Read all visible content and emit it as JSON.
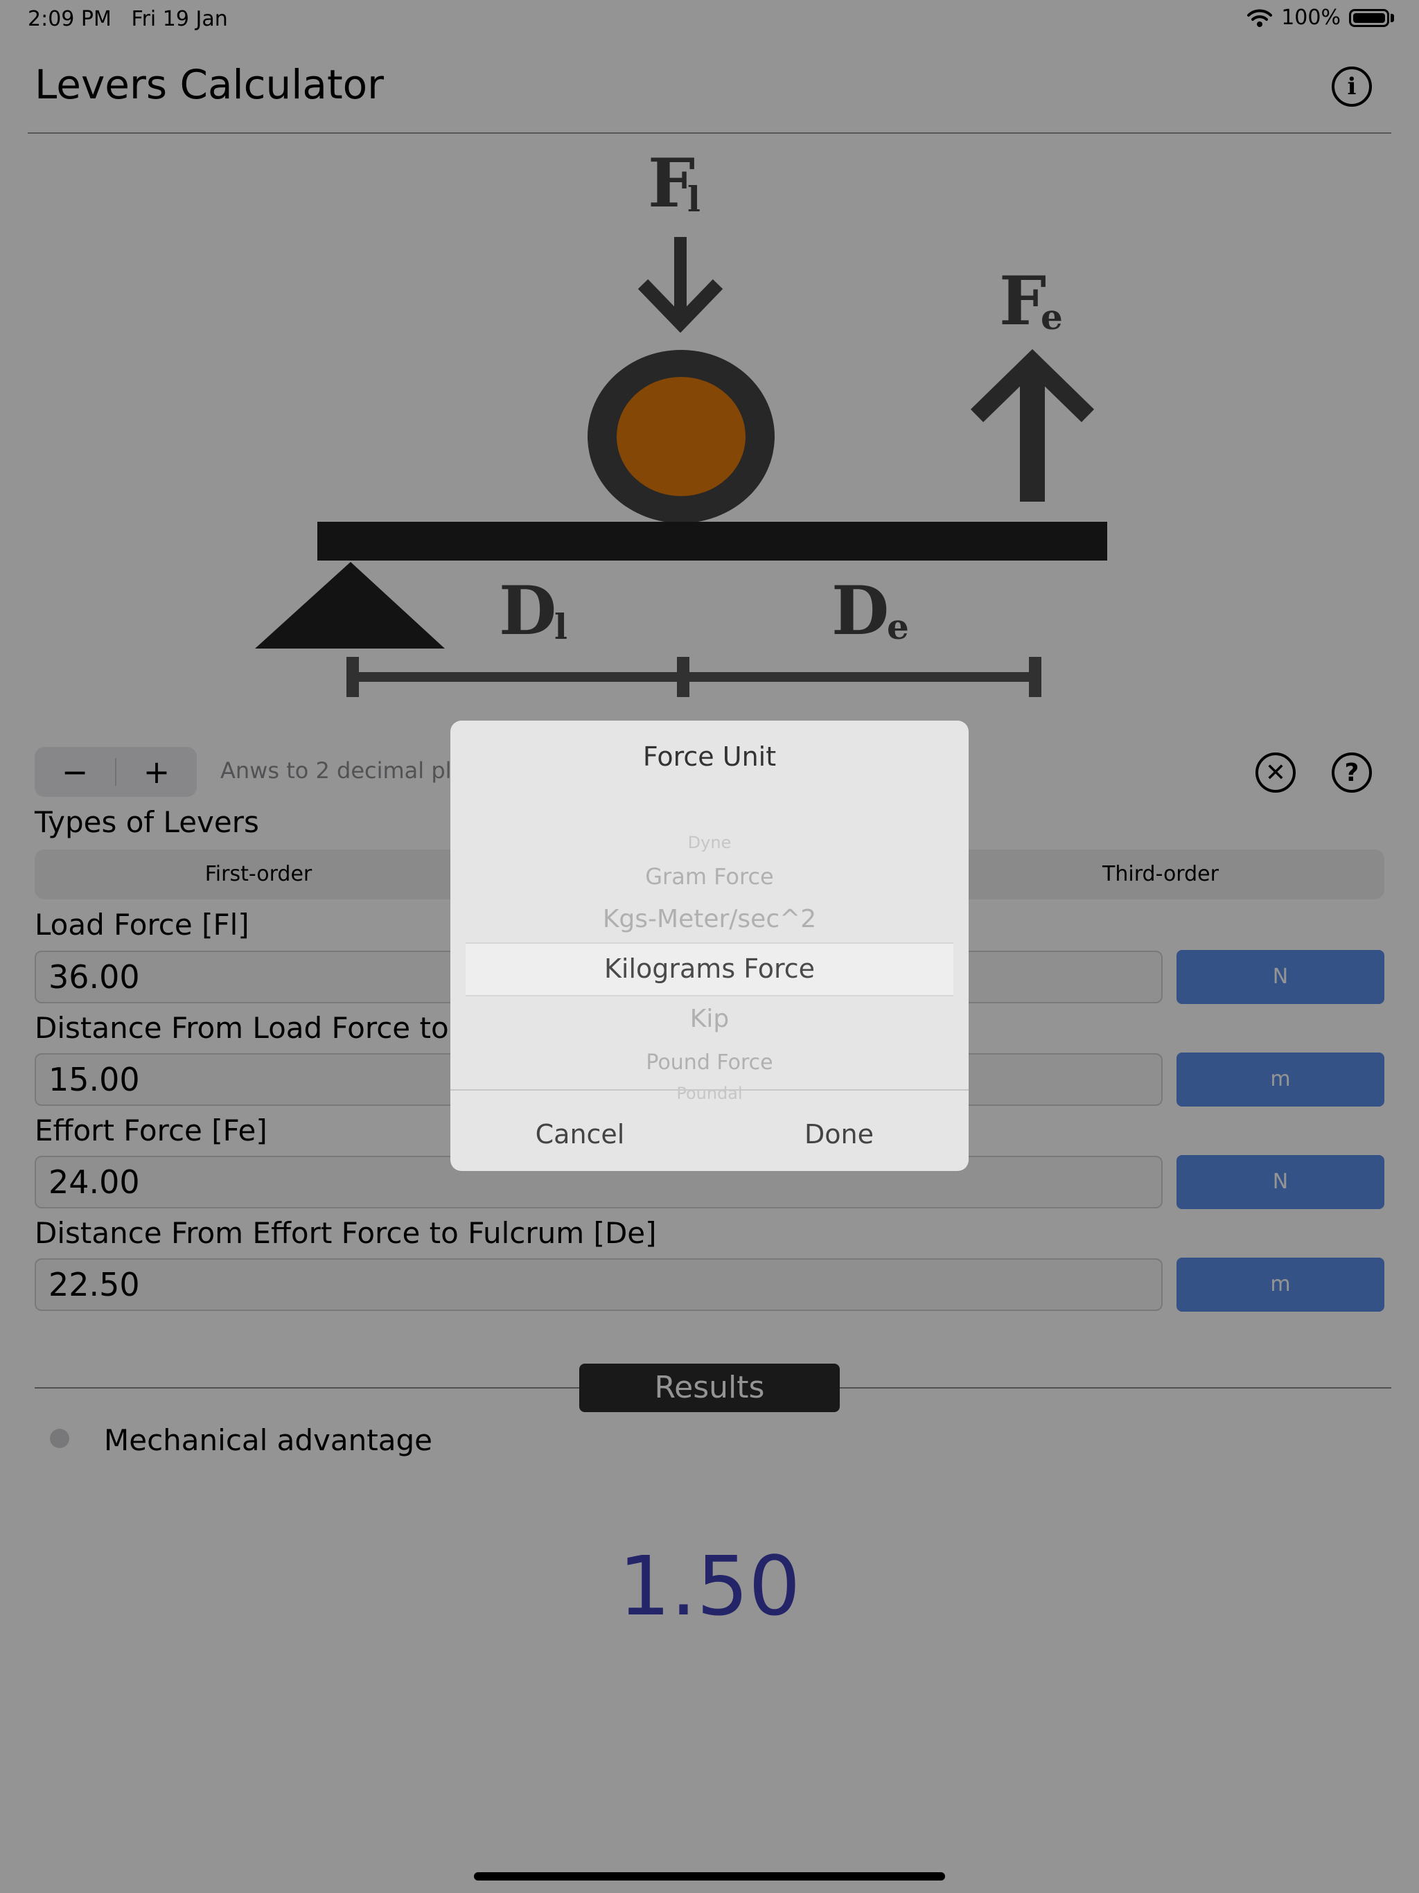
{
  "status_bar": {
    "time": "2:09 PM",
    "date": "Fri 19 Jan",
    "battery": "100%"
  },
  "nav": {
    "title": "Levers Calculator",
    "info_icon": "info-icon"
  },
  "diagram": {
    "load_label": "F",
    "load_sub": "l",
    "effort_label": "F",
    "effort_sub": "e",
    "dist_load_label": "D",
    "dist_load_sub": "l",
    "dist_effort_label": "D",
    "dist_effort_sub": "e",
    "ball_color": "#e37a0c"
  },
  "toolbar": {
    "minus": "−",
    "plus": "+",
    "decimal_text": "Anws to 2 decimal pl",
    "clear_icon": "close-circle-icon",
    "help_icon": "question-circle-icon"
  },
  "types": {
    "label": "Types of Levers",
    "first": "First-order",
    "third": "Third-order"
  },
  "fields": {
    "load_force": {
      "label": "Load Force [Fl]",
      "value": "36.00",
      "unit": "N"
    },
    "load_distance": {
      "label": "Distance From Load Force to F",
      "value": "15.00",
      "unit": "m"
    },
    "effort_force": {
      "label": "Effort Force [Fe]",
      "value": "24.00",
      "unit": "N"
    },
    "effort_distance": {
      "label": "Distance From Effort Force to Fulcrum [De]",
      "value": "22.50",
      "unit": "m"
    }
  },
  "results": {
    "title": "Results",
    "option": "Mechanical advantage",
    "value": "1.50"
  },
  "alert": {
    "title": "Force Unit",
    "options": [
      "Dyne",
      "Gram Force",
      "Kgs-Meter/sec^2",
      "Kilograms Force",
      "Kip",
      "Pound Force",
      "Poundal"
    ],
    "selected": "Kilograms Force",
    "cancel": "Cancel",
    "done": "Done"
  },
  "colors": {
    "accent": "#5b8ee6",
    "result": "#3f3fb4",
    "pill": "#2c2c2e"
  }
}
